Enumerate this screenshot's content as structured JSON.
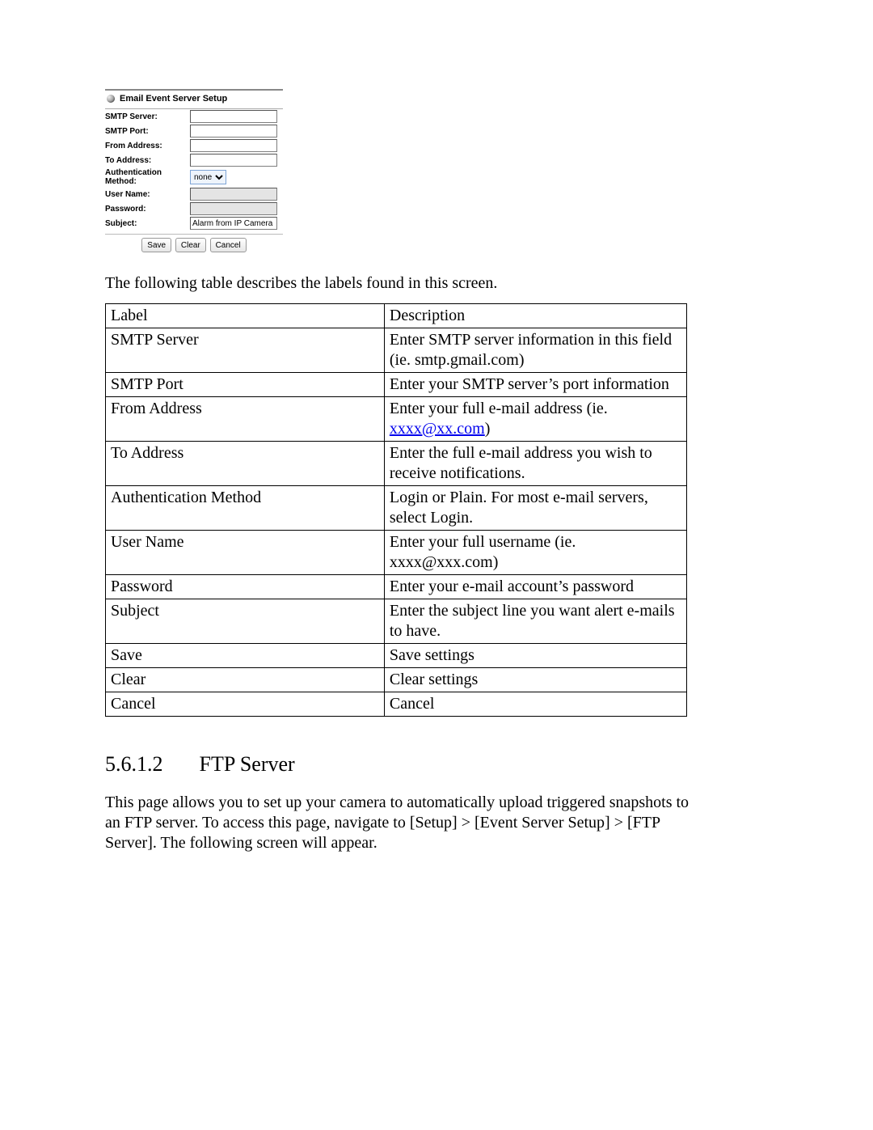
{
  "panel": {
    "title": "Email Event Server Setup",
    "labels": {
      "smtp_server": "SMTP Server:",
      "smtp_port": "SMTP Port:",
      "from_address": "From Address:",
      "to_address": "To Address:",
      "auth_method": "Authentication Method:",
      "user_name": "User Name:",
      "password": "Password:",
      "subject": "Subject:"
    },
    "values": {
      "smtp_server": "",
      "smtp_port": "",
      "from_address": "",
      "to_address": "",
      "auth_method": "none",
      "user_name": "",
      "password": "",
      "subject": "Alarm from IP Camera"
    },
    "buttons": {
      "save": "Save",
      "clear": "Clear",
      "cancel": "Cancel"
    }
  },
  "intro_text": "The following table describes the labels found in this screen.",
  "table": {
    "header": {
      "label": "Label",
      "description": "Description"
    },
    "rows": [
      {
        "label": "SMTP Server",
        "desc_pre": "Enter SMTP server information in this field (ie. smtp.gmail.com)",
        "link": "",
        "desc_post": ""
      },
      {
        "label": "SMTP Port",
        "desc_pre": "Enter your SMTP server’s port information",
        "link": "",
        "desc_post": ""
      },
      {
        "label": "From Address",
        "desc_pre": "Enter your full e-mail address (ie. ",
        "link": "xxxx@xx.com",
        "desc_post": ")"
      },
      {
        "label": "To Address",
        "desc_pre": "Enter the full e-mail address you wish to receive notifications.",
        "link": "",
        "desc_post": ""
      },
      {
        "label": "Authentication Method",
        "desc_pre": "Login or Plain. For most e-mail servers, select Login.",
        "link": "",
        "desc_post": ""
      },
      {
        "label": "User Name",
        "desc_pre": "Enter your full username (ie. xxxx@xxx.com)",
        "link": "",
        "desc_post": ""
      },
      {
        "label": "Password",
        "desc_pre": "Enter your e-mail account’s password",
        "link": "",
        "desc_post": ""
      },
      {
        "label": "Subject",
        "desc_pre": "Enter the subject line you want alert e-mails to have.",
        "link": "",
        "desc_post": ""
      },
      {
        "label": "Save",
        "desc_pre": "Save settings",
        "link": "",
        "desc_post": ""
      },
      {
        "label": "Clear",
        "desc_pre": "Clear settings",
        "link": "",
        "desc_post": ""
      },
      {
        "label": "Cancel",
        "desc_pre": "Cancel",
        "link": "",
        "desc_post": ""
      }
    ]
  },
  "section": {
    "number": "5.6.1.2",
    "title": "FTP Server",
    "body": "This page allows you to set up your camera to automatically upload triggered snapshots to an FTP server.  To access this page, navigate to [Setup] > [Event Server Setup] > [FTP Server]. The following screen will appear."
  }
}
